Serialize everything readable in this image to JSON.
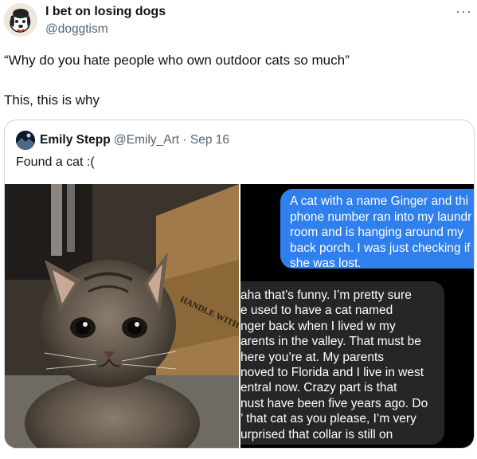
{
  "tweet": {
    "author_name": "I bet on losing dogs",
    "author_handle": "@doggtism",
    "more_icon": "more-horizontal-icon",
    "text_line1": "“Why do you hate people who own outdoor cats so much”",
    "text_line2": "This, this is why"
  },
  "quoted": {
    "author_name": "Emily Stepp",
    "author_handle": "@Emily_Art",
    "separator": "·",
    "date": "Sep 16",
    "text": "Found a cat :(",
    "box_text": "HANDLE WITH CARE"
  },
  "chat": {
    "outgoing": [
      "A cat with a name Ginger and thi",
      "phone number ran into my laundr",
      "room and is hanging around my",
      "back porch. I was just checking if",
      "she was lost."
    ],
    "incoming": [
      "aha that’s funny. I’m pretty sure",
      "e used to have a cat named",
      "nger back when I lived w my",
      "arents in the valley. That must be",
      "here you’re at. My parents",
      "noved to Florida and I live in west",
      "entral now. Crazy part is that",
      "nust have been five years ago. Do",
      "’ that cat as you please, I’m very",
      "urprised that collar is still on"
    ],
    "outgoing_color": "#2f80ed",
    "incoming_color": "#262628"
  }
}
